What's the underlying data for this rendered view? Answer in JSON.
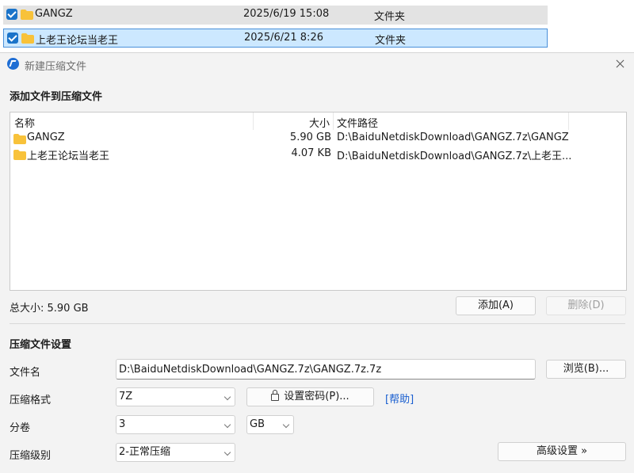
{
  "explorer": {
    "rows": [
      {
        "name": "GANGZ",
        "date": "2025/6/19 15:08",
        "type": "文件夹"
      },
      {
        "name": "上老王论坛当老王",
        "date": "2025/6/21 8:26",
        "type": "文件夹"
      }
    ]
  },
  "dialog": {
    "title": "新建压缩文件",
    "add_section_title": "添加文件到压缩文件",
    "columns": {
      "name": "名称",
      "size": "大小",
      "path": "文件路径"
    },
    "files": [
      {
        "name": "GANGZ",
        "size": "5.90 GB",
        "path": "D:\\BaiduNetdiskDownload\\GANGZ.7z\\GANGZ"
      },
      {
        "name": "上老王论坛当老王",
        "size": "4.07 KB",
        "path": "D:\\BaiduNetdiskDownload\\GANGZ.7z\\上老王..."
      }
    ],
    "total_size": "总大小: 5.90 GB",
    "add_button": "添加(A)",
    "delete_button": "删除(D)",
    "settings_title": "压缩文件设置",
    "filename_label": "文件名",
    "filename_value": "D:\\BaiduNetdiskDownload\\GANGZ.7z\\GANGZ.7z.7z",
    "browse_button": "浏览(B)...",
    "format_label": "压缩格式",
    "format_value": "7Z",
    "set_password_button": "设置密码(P)...",
    "help_link": "[帮助]",
    "volume_label": "分卷",
    "volume_value": "3",
    "volume_unit": "GB",
    "level_label": "压缩级别",
    "level_value": "2-正常压缩",
    "advanced_button": "高级设置 »"
  },
  "colors": {
    "accent": "#1a73c9",
    "selection": "#cce8ff",
    "folder": "#f8c23a",
    "link": "#1a5fd0"
  },
  "icons": [
    "checkbox-checked-icon",
    "folder-icon",
    "app-icon",
    "close-icon",
    "lock-icon",
    "chevron-down-icon"
  ]
}
